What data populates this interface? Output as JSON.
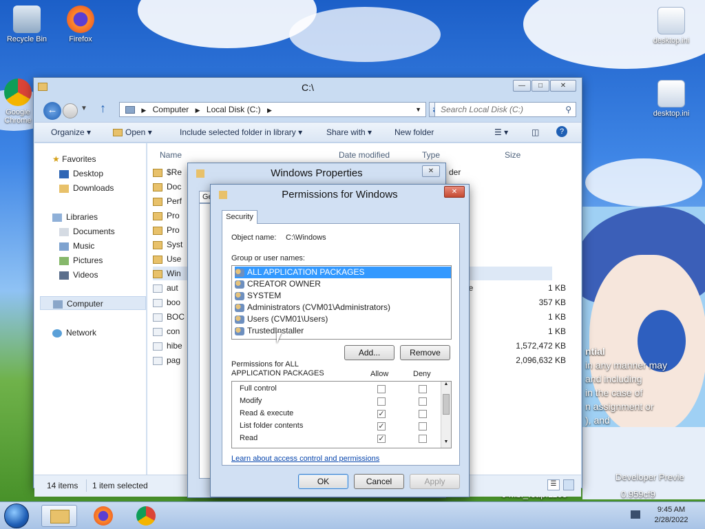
{
  "colors": {
    "selection": "#3399ff",
    "accent": "#1e5fb4",
    "close_red": "#c44a31"
  },
  "desktop": {
    "icons": [
      {
        "label": "Recycle Bin",
        "icon": "recycle-bin-icon"
      },
      {
        "label": "Firefox",
        "icon": "firefox-icon"
      },
      {
        "label": "Google Chrome",
        "icon": "chrome-icon"
      },
      {
        "label": "desktop.ini",
        "icon": "ini-file-icon"
      },
      {
        "label": "desktop.ini",
        "icon": "ini-file-icon"
      }
    ],
    "watermark": {
      "line1": "ntial",
      "line2": "in any manner may",
      "line3": "and including",
      "line4": "in the case of",
      "line5": "n assignment or",
      "line6": "), and",
      "build1": "Developer Previe",
      "build2": "64.fbl_.eap.1108",
      "build3": "0.959cf9"
    }
  },
  "explorer": {
    "title": "C:\\",
    "breadcrumb": [
      "Computer",
      "Local Disk (C:)"
    ],
    "search_placeholder": "Search Local Disk (C:)",
    "toolbar": {
      "organize": "Organize",
      "open": "Open",
      "include": "Include selected folder in library",
      "share": "Share with",
      "new_folder": "New folder"
    },
    "nav": {
      "favorites": "Favorites",
      "desktop": "Desktop",
      "downloads": "Downloads",
      "libraries": "Libraries",
      "documents": "Documents",
      "music": "Music",
      "pictures": "Pictures",
      "videos": "Videos",
      "computer": "Computer",
      "network": "Network"
    },
    "columns": {
      "name": "Name",
      "date": "Date modified",
      "type": "Type",
      "size": "Size"
    },
    "rows": [
      {
        "name": "$Re",
        "type": "der",
        "size": ""
      },
      {
        "name": "Doc",
        "type": "",
        "size": ""
      },
      {
        "name": "Perf",
        "type": "",
        "size": ""
      },
      {
        "name": "Pro",
        "type": "",
        "size": ""
      },
      {
        "name": "Pro",
        "type": "",
        "size": ""
      },
      {
        "name": "Syst",
        "type": "",
        "size": ""
      },
      {
        "name": "Use",
        "type": "",
        "size": ""
      },
      {
        "name": "Win",
        "type": "",
        "size": ""
      },
      {
        "name": "aut",
        "type": "ch File",
        "size": "1 KB"
      },
      {
        "name": "boo",
        "type": "",
        "size": "357 KB"
      },
      {
        "name": "BOC",
        "type": "",
        "size": "1 KB"
      },
      {
        "name": "con",
        "type": "",
        "size": "1 KB"
      },
      {
        "name": "hibe",
        "type": "",
        "size": "1,572,472 KB"
      },
      {
        "name": "pag",
        "type": "",
        "size": "2,096,632 KB"
      }
    ],
    "status": {
      "items": "14 items",
      "selected": "1 item selected"
    }
  },
  "props_dialog": {
    "title": "Windows Properties",
    "tab": "Ge"
  },
  "perm_dialog": {
    "title": "Permissions for Windows",
    "tab": "Security",
    "object_label": "Object name:",
    "object_value": "C:\\Windows",
    "group_label": "Group or user names:",
    "users": [
      "ALL APPLICATION PACKAGES",
      "CREATOR OWNER",
      "SYSTEM",
      "Administrators (CVM01\\Administrators)",
      "Users (CVM01\\Users)",
      "TrustedInstaller"
    ],
    "add": "Add...",
    "remove": "Remove",
    "perms_label_1": "Permissions for ALL",
    "perms_label_2": "APPLICATION PACKAGES",
    "allow": "Allow",
    "deny": "Deny",
    "permissions": [
      {
        "name": "Full control",
        "allow": false,
        "deny": false
      },
      {
        "name": "Modify",
        "allow": false,
        "deny": false
      },
      {
        "name": "Read & execute",
        "allow": true,
        "deny": false
      },
      {
        "name": "List folder contents",
        "allow": true,
        "deny": false
      },
      {
        "name": "Read",
        "allow": true,
        "deny": false
      }
    ],
    "learn_link": "Learn about access control and permissions",
    "ok": "OK",
    "cancel": "Cancel",
    "apply": "Apply"
  },
  "taskbar": {
    "time": "9:45 AM",
    "date": "2/28/2022"
  }
}
